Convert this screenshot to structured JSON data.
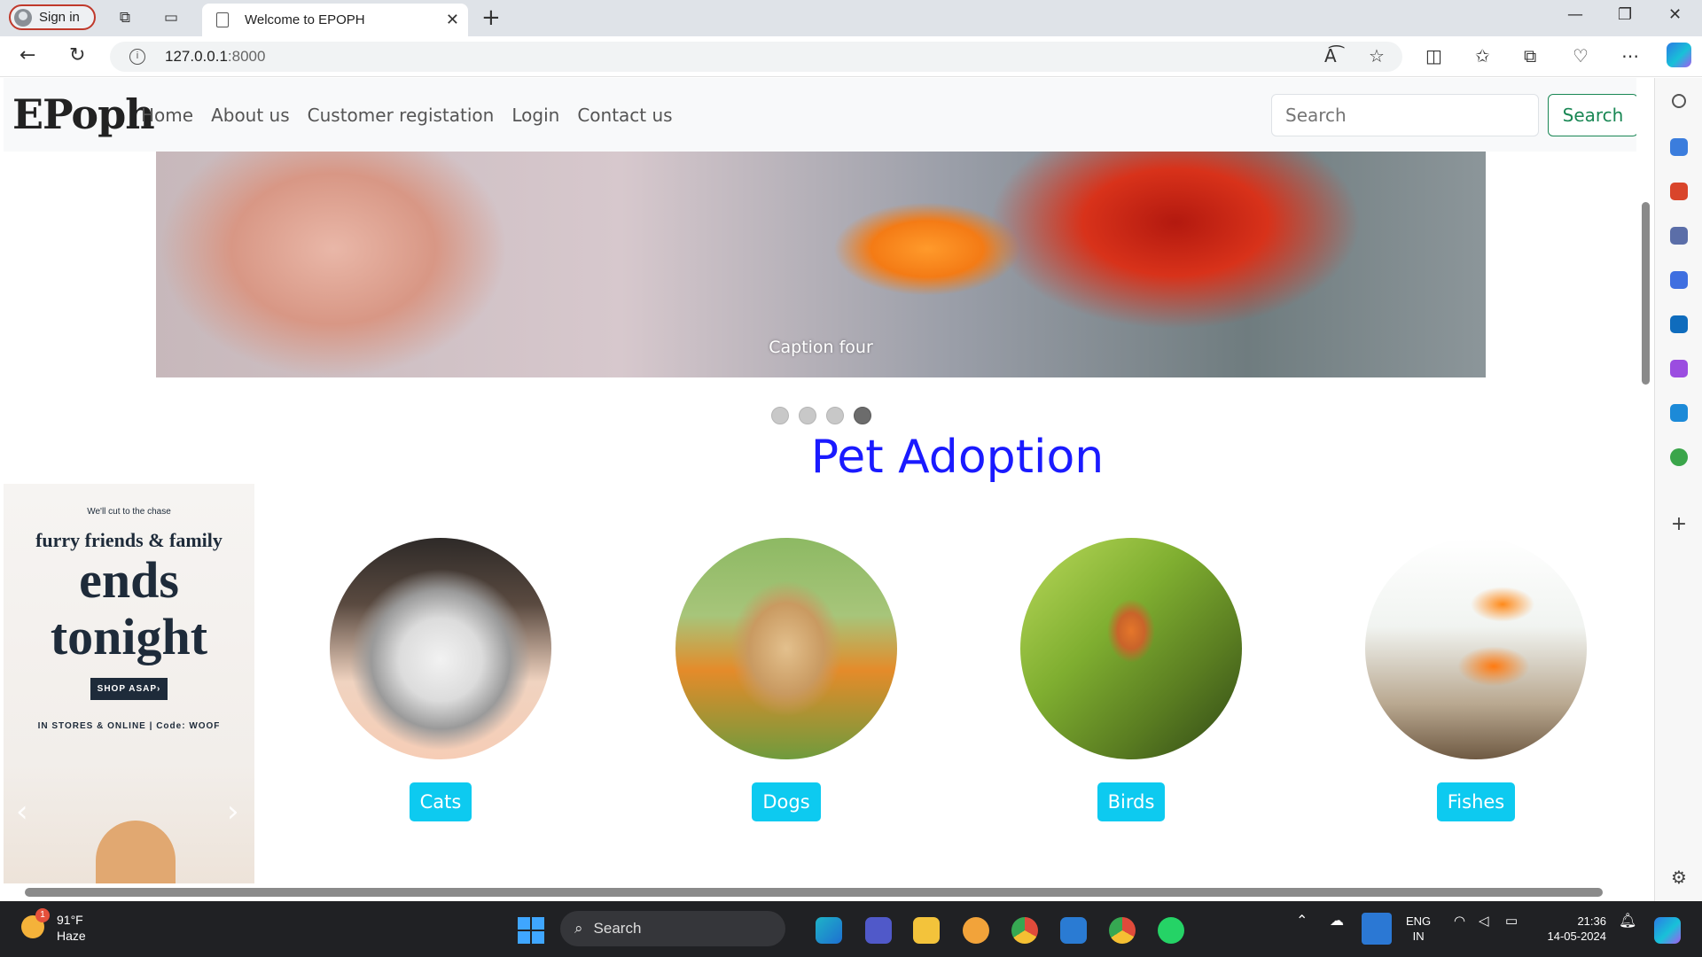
{
  "browser": {
    "profile_label": "Sign in",
    "tab_title": "Welcome to EPOPH",
    "url_host": "127.0.0.1",
    "url_port": ":8000",
    "accent": "#0dcaf0"
  },
  "navbar": {
    "brand": "EPoph",
    "links": [
      "Home",
      "About us",
      "Customer registation",
      "Login",
      "Contact us"
    ],
    "search_placeholder": "Search",
    "search_button": "Search"
  },
  "carousel": {
    "caption": "Caption four",
    "slide_count": 4,
    "active_index": 3
  },
  "main": {
    "heading": "Pet Adoption",
    "categories": [
      {
        "label": "Cats"
      },
      {
        "label": "Dogs"
      },
      {
        "label": "Birds"
      },
      {
        "label": "Fishes"
      }
    ]
  },
  "ad": {
    "line1": "We'll cut to the chase",
    "line2": "furry friends & family",
    "line3": "ends",
    "line4": "tonight",
    "cta": "SHOP ASAP›",
    "footer": "IN STORES & ONLINE | Code: WOOF"
  },
  "taskbar": {
    "weather_temp": "91°F",
    "weather_desc": "Haze",
    "weather_badge": "1",
    "search_label": "Search",
    "lang_top": "ENG",
    "lang_bottom": "IN",
    "time": "21:36",
    "date": "14-05-2024"
  }
}
